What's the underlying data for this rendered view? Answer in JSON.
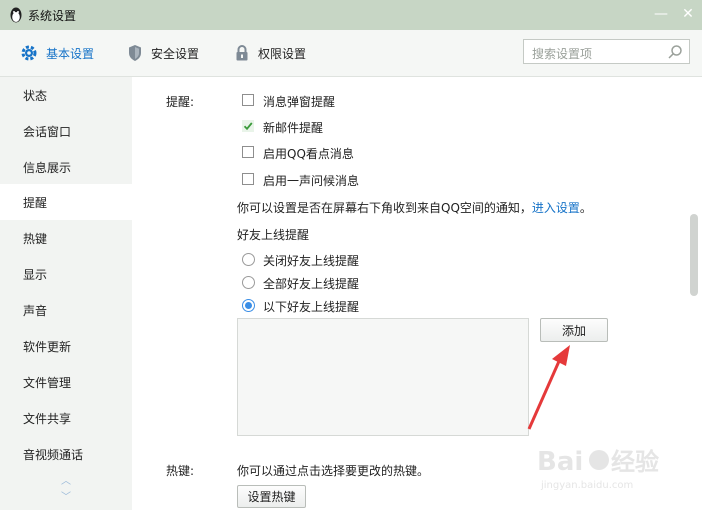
{
  "window": {
    "title": "系统设置",
    "minimize": "—",
    "close": "✕"
  },
  "nav": {
    "tabs": [
      {
        "label": "基本设置",
        "icon": "gear-icon",
        "active": true
      },
      {
        "label": "安全设置",
        "icon": "shield-icon",
        "active": false
      },
      {
        "label": "权限设置",
        "icon": "lock-icon",
        "active": false
      }
    ],
    "search_placeholder": "搜索设置项"
  },
  "sidebar": {
    "items": [
      "状态",
      "会话窗口",
      "信息展示",
      "提醒",
      "热键",
      "显示",
      "声音",
      "软件更新",
      "文件管理",
      "文件共享",
      "音视频通话"
    ],
    "active_index": 3
  },
  "reminder": {
    "section_label": "提醒:",
    "options": [
      {
        "label": "消息弹窗提醒",
        "checked": false
      },
      {
        "label": "新邮件提醒",
        "checked": true
      },
      {
        "label": "启用QQ看点消息",
        "checked": false
      },
      {
        "label": "启用一声问候消息",
        "checked": false
      }
    ],
    "note": "你可以设置是否在屏幕右下角收到来自QQ空间的通知，",
    "note_link": "进入设置",
    "note_end": "。"
  },
  "friend_online": {
    "title": "好友上线提醒",
    "options": [
      {
        "label": "关闭好友上线提醒",
        "selected": false
      },
      {
        "label": "全部好友上线提醒",
        "selected": false
      },
      {
        "label": "以下好友上线提醒",
        "selected": true
      }
    ],
    "add_button": "添加"
  },
  "hotkey": {
    "section_label": "热键:",
    "note": "你可以通过点击选择要更改的热键。",
    "button": "设置热键"
  },
  "colors": {
    "accent": "#1673c8",
    "titlebar": "#c7d6c5",
    "arrow": "#e5393a"
  }
}
